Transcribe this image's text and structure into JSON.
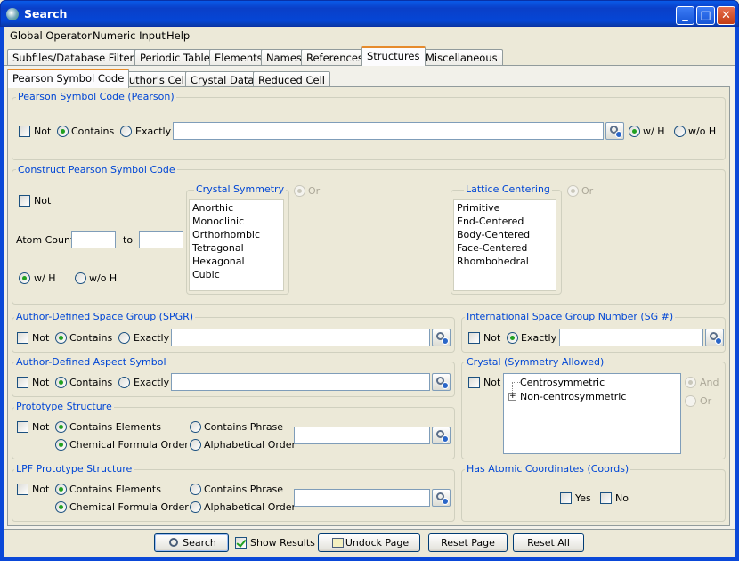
{
  "window": {
    "title": "Search"
  },
  "menu": [
    "Global Operator",
    "Numeric Input",
    "Help"
  ],
  "main_tabs": [
    "Subfiles/Database Filters",
    "Periodic Table",
    "Elements",
    "Names",
    "References",
    "Structures",
    "Miscellaneous"
  ],
  "main_tab_active": "Structures",
  "sub_tabs": [
    "Pearson Symbol Code",
    "Author's Cell",
    "Crystal Data",
    "Reduced Cell"
  ],
  "sub_tab_active": "Pearson Symbol Code",
  "common": {
    "not": "Not",
    "contains": "Contains",
    "exactly": "Exactly",
    "wh": "w/ H",
    "woh": "w/o H",
    "or": "Or",
    "and": "And"
  },
  "pearson": {
    "title": "Pearson Symbol Code (Pearson)",
    "value": "",
    "mode": "Contains",
    "hydrogen": "w/ H"
  },
  "construct": {
    "title": "Construct Pearson Symbol Code",
    "atom_count_label": "Atom Count:",
    "to_label": "to",
    "hydrogen": "w/ H",
    "crystal_symmetry": {
      "title": "Crystal Symmetry",
      "items": [
        "Anorthic",
        "Monoclinic",
        "Orthorhombic",
        "Tetragonal",
        "Hexagonal",
        "Cubic"
      ]
    },
    "lattice_centering": {
      "title": "Lattice Centering",
      "items": [
        "Primitive",
        "End-Centered",
        "Body-Centered",
        "Face-Centered",
        "Rhombohedral"
      ]
    }
  },
  "spgr": {
    "title": "Author-Defined Space Group (SPGR)",
    "mode": "Contains"
  },
  "sgnum": {
    "title": "International Space Group Number (SG #)",
    "mode": "Exactly"
  },
  "aspect": {
    "title": "Author-Defined Aspect Symbol",
    "mode": "Contains"
  },
  "crystal_sym": {
    "title": "Crystal (Symmetry Allowed)",
    "tree": [
      "Centrosymmetric",
      "Non-centrosymmetric"
    ]
  },
  "prototype": {
    "title": "Prototype Structure",
    "contains_elements": "Contains Elements",
    "contains_phrase": "Contains Phrase",
    "chem_order": "Chemical Formula Order",
    "alpha_order": "Alphabetical Order"
  },
  "lpf": {
    "title": "LPF Prototype Structure"
  },
  "coords": {
    "title": "Has Atomic Coordinates (Coords)",
    "yes": "Yes",
    "no": "No"
  },
  "bottom": {
    "search": "Search",
    "show_results": "Show Results",
    "undock": "Undock Page",
    "reset_page": "Reset Page",
    "reset_all": "Reset All"
  }
}
